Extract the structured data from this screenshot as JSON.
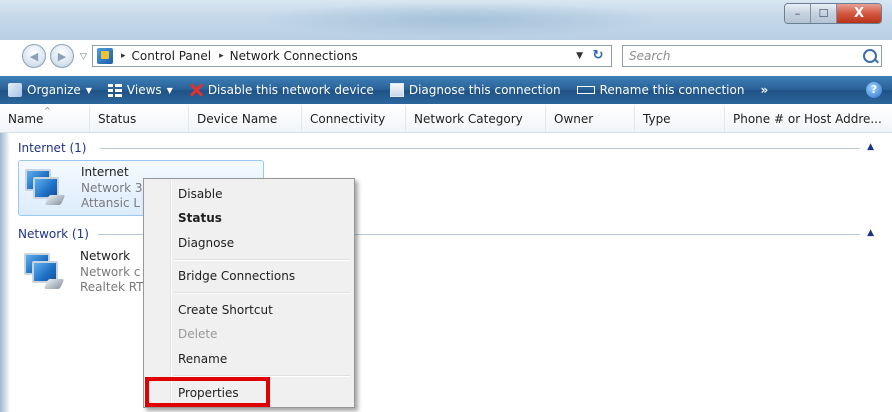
{
  "window": {
    "minimize_glyph": "–",
    "maximize_glyph": "☐",
    "close_glyph": "X"
  },
  "address": {
    "path": [
      "Control Panel",
      "Network Connections"
    ],
    "separator": "▸",
    "search_placeholder": "Search"
  },
  "toolbar": {
    "items": [
      {
        "label": "Organize",
        "icon": "organize-icon",
        "has_caret": true
      },
      {
        "label": "Views",
        "icon": "views-icon",
        "has_caret": true
      },
      {
        "label": "Disable this network device",
        "icon": "disable-icon"
      },
      {
        "label": "Diagnose this connection",
        "icon": "diagnose-icon"
      },
      {
        "label": "Rename this connection",
        "icon": "rename-icon"
      }
    ],
    "more": "»",
    "help": "?",
    "colors": {
      "bar": "#2a6298",
      "text": "#ffffff"
    }
  },
  "columns": [
    "Name",
    "Status",
    "Device Name",
    "Connectivity",
    "Network Category",
    "Owner",
    "Type",
    "Phone # or Host Addre..."
  ],
  "groups": [
    {
      "title": "Internet (1)",
      "item": {
        "name": "Internet",
        "line1": "Network 3",
        "line2": "Attansic L",
        "selected": true
      }
    },
    {
      "title": "Network (1)",
      "item": {
        "name": "Network",
        "line1": "Network c",
        "line2": "Realtek RT",
        "selected": false
      }
    }
  ],
  "context_menu": {
    "items": [
      {
        "label": "Disable",
        "style": "normal"
      },
      {
        "label": "Status",
        "style": "bold"
      },
      {
        "label": "Diagnose",
        "style": "normal"
      },
      {
        "label": "Bridge Connections",
        "style": "normal"
      },
      {
        "label": "Create Shortcut",
        "style": "normal"
      },
      {
        "label": "Delete",
        "style": "disabled"
      },
      {
        "label": "Rename",
        "style": "normal"
      },
      {
        "label": "Properties",
        "style": "normal",
        "highlighted": true
      }
    ],
    "highlight_color": "#e00000"
  }
}
